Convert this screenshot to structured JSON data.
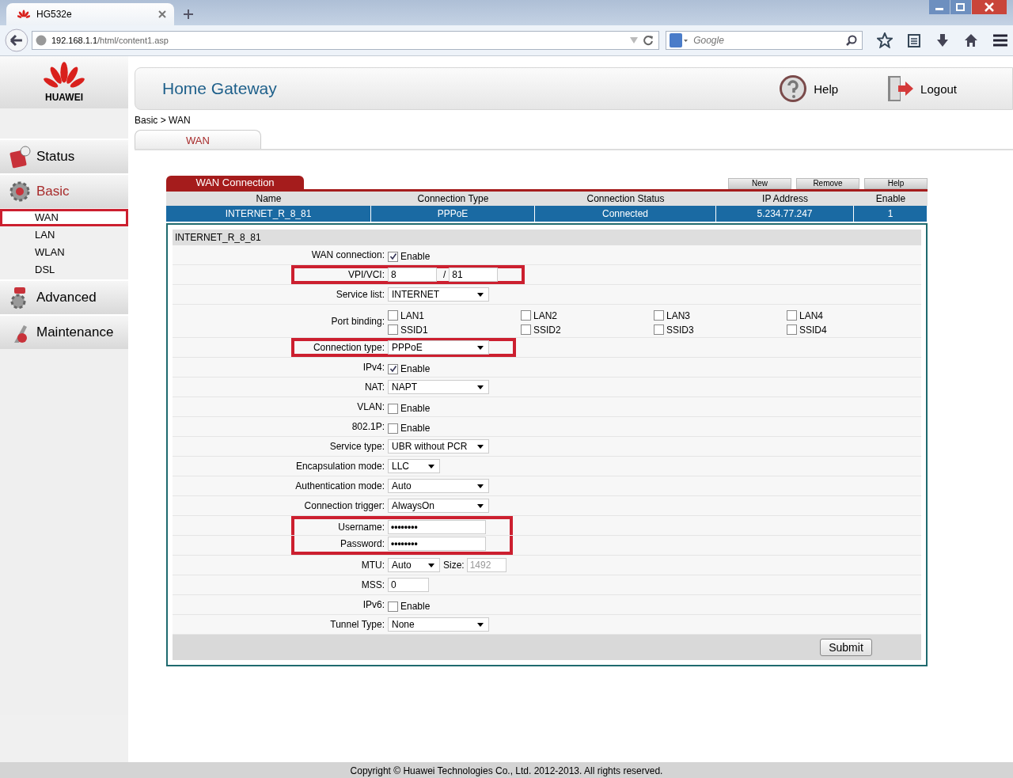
{
  "browser": {
    "tab_title": "HG532e",
    "url_host": "192.168.1.1",
    "url_path": "/html/content1.asp",
    "search_placeholder": "Google"
  },
  "header": {
    "brand": "HUAWEI",
    "title": "Home Gateway",
    "help": "Help",
    "logout": "Logout"
  },
  "breadcrumb": "Basic > WAN",
  "tabs": [
    {
      "label": "WAN",
      "selected": true
    }
  ],
  "sidebar": {
    "items": [
      {
        "label": "Status",
        "kind": "status",
        "selected": false
      },
      {
        "label": "Basic",
        "kind": "basic",
        "selected": true,
        "children": [
          {
            "label": "WAN",
            "selected": true,
            "highlighted": true
          },
          {
            "label": "LAN",
            "selected": false,
            "highlighted": false
          },
          {
            "label": "WLAN",
            "selected": false,
            "highlighted": false
          },
          {
            "label": "DSL",
            "selected": false,
            "highlighted": false
          }
        ]
      },
      {
        "label": "Advanced",
        "kind": "advanced",
        "selected": false
      },
      {
        "label": "Maintenance",
        "kind": "maintenance",
        "selected": false
      }
    ]
  },
  "wan_table": {
    "title": "WAN Connection",
    "buttons": [
      "New",
      "Remove",
      "Help"
    ],
    "columns": [
      "Name",
      "Connection Type",
      "Connection Status",
      "IP Address",
      "Enable"
    ],
    "rows": [
      {
        "cells": [
          "INTERNET_R_8_81",
          "PPPoE",
          "Connected",
          "5.234.77.247",
          "1"
        ],
        "selected": true
      }
    ]
  },
  "form": {
    "title": "INTERNET_R_8_81",
    "submit": "Submit",
    "rows": [
      {
        "kind": "check",
        "label": "WAN connection:",
        "checked": true,
        "text": "Enable",
        "highlighted": false
      },
      {
        "kind": "pair",
        "label": "VPI/VCI:",
        "value": "8",
        "separator": "/",
        "value2": "81",
        "highlighted": true
      },
      {
        "kind": "select",
        "label": "Service list:",
        "value": "INTERNET",
        "highlighted": false
      },
      {
        "kind": "ports",
        "label": "Port binding:",
        "highlighted": false,
        "options": [
          {
            "label": "LAN1",
            "checked": false
          },
          {
            "label": "LAN2",
            "checked": false
          },
          {
            "label": "LAN3",
            "checked": false
          },
          {
            "label": "LAN4",
            "checked": false
          },
          {
            "label": "SSID1",
            "checked": false
          },
          {
            "label": "SSID2",
            "checked": false
          },
          {
            "label": "SSID3",
            "checked": false
          },
          {
            "label": "SSID4",
            "checked": false
          }
        ]
      },
      {
        "kind": "select",
        "label": "Connection type:",
        "value": "PPPoE",
        "highlighted": true
      },
      {
        "kind": "check",
        "label": "IPv4:",
        "checked": true,
        "text": "Enable",
        "highlighted": false
      },
      {
        "kind": "select",
        "label": "NAT:",
        "value": "NAPT",
        "highlighted": false
      },
      {
        "kind": "check",
        "label": "VLAN:",
        "checked": false,
        "text": "Enable",
        "highlighted": false
      },
      {
        "kind": "check",
        "label": "802.1P:",
        "checked": false,
        "text": "Enable",
        "highlighted": false
      },
      {
        "kind": "select",
        "label": "Service type:",
        "value": "UBR without PCR",
        "highlighted": false
      },
      {
        "kind": "select-short",
        "label": "Encapsulation mode:",
        "value": "LLC",
        "highlighted": false
      },
      {
        "kind": "select",
        "label": "Authentication mode:",
        "value": "Auto",
        "highlighted": false
      },
      {
        "kind": "select",
        "label": "Connection trigger:",
        "value": "AlwaysOn",
        "highlighted": false
      },
      {
        "kind": "secret",
        "label": "Username:",
        "value": "••••••••",
        "highlighted": true
      },
      {
        "kind": "secret",
        "label": "Password:",
        "value": "••••••••",
        "highlighted": true
      },
      {
        "kind": "mtu",
        "label": "MTU:",
        "value": "Auto",
        "size_label": "Size:",
        "size_value": "1492",
        "highlighted": false
      },
      {
        "kind": "text",
        "label": "MSS:",
        "value": "0",
        "highlighted": false
      },
      {
        "kind": "check",
        "label": "IPv6:",
        "checked": false,
        "text": "Enable",
        "highlighted": false
      },
      {
        "kind": "select",
        "label": "Tunnel Type:",
        "value": "None",
        "highlighted": false
      }
    ]
  },
  "footer": "Copyright © Huawei Technologies Co., Ltd. 2012-2013. All rights reserved."
}
